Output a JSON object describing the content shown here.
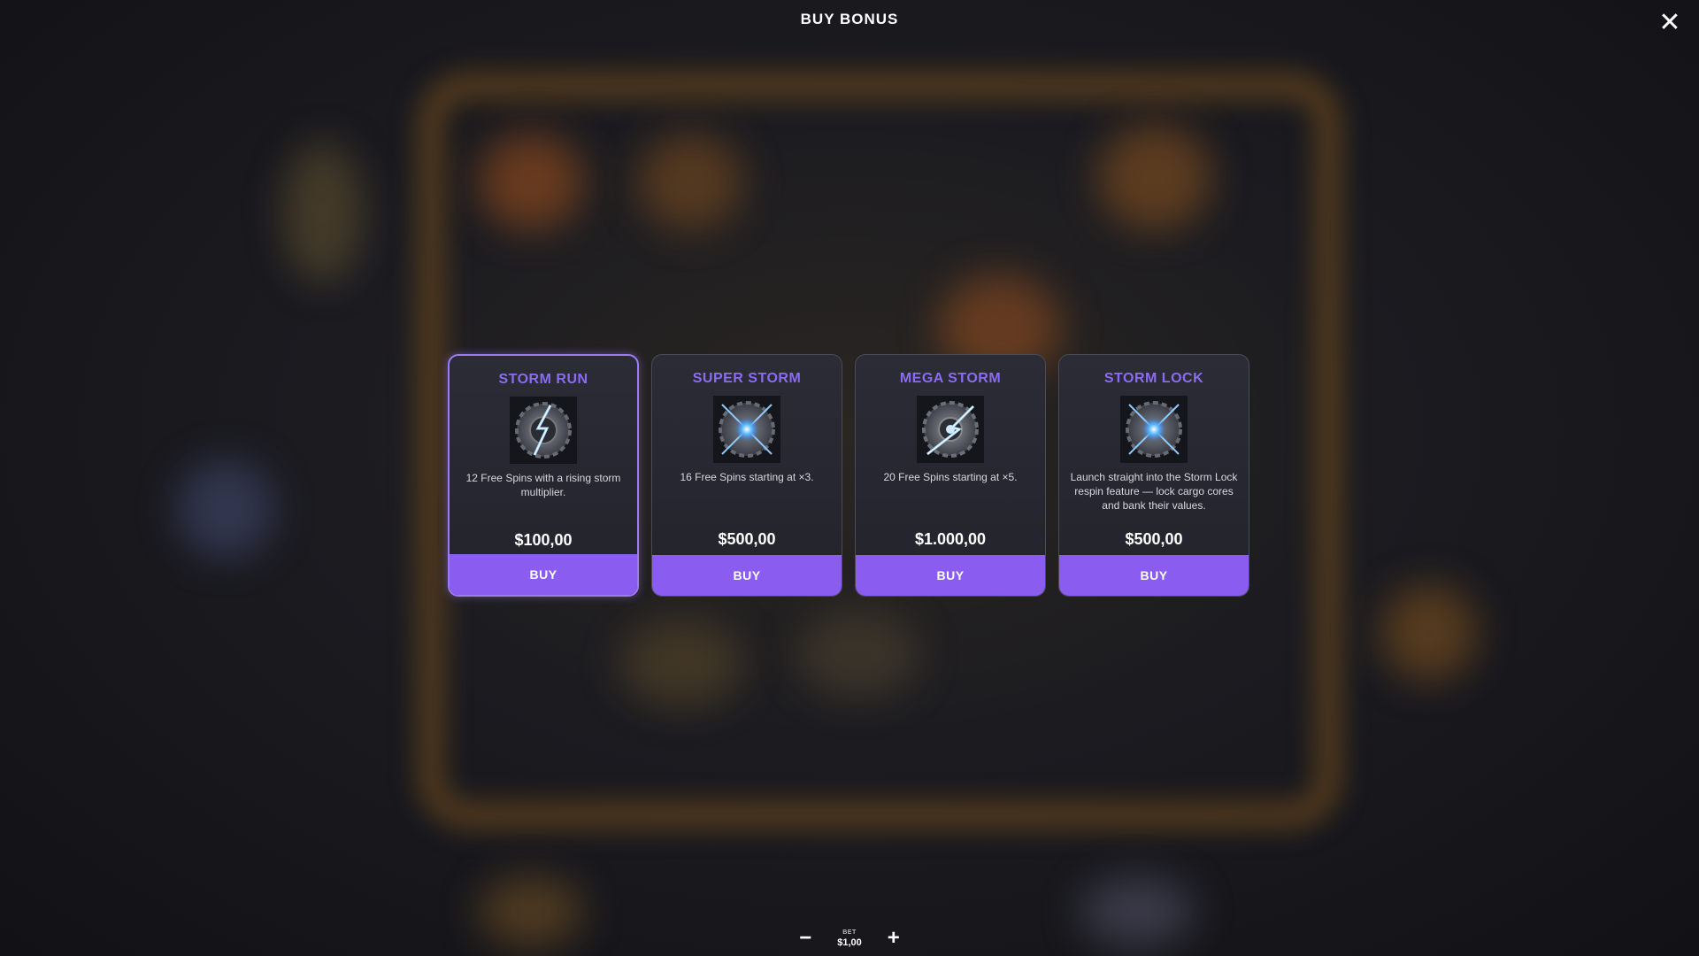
{
  "modal": {
    "title": "BUY BONUS",
    "close_icon": "close-icon"
  },
  "colors": {
    "accent": "#8b5cf0",
    "title_purple": "#8b6cf0",
    "card_bg": "#2b2c36",
    "selected_border": "#9b7cf4"
  },
  "bonuses": [
    {
      "name": "STORM RUN",
      "icon": "lightning-gear-icon",
      "description": "12 Free Spins with a rising storm multiplier.",
      "price": "$100,00",
      "buy_label": "BUY",
      "selected": true
    },
    {
      "name": "SUPER STORM",
      "icon": "storm-core-gear-icon",
      "description": "16 Free Spins starting at ×3.",
      "price": "$500,00",
      "buy_label": "BUY",
      "selected": false
    },
    {
      "name": "MEGA STORM",
      "icon": "lightning-gear-icon",
      "description": "20 Free Spins starting at ×5.",
      "price": "$1.000,00",
      "buy_label": "BUY",
      "selected": false
    },
    {
      "name": "STORM LOCK",
      "icon": "storm-core-gear-icon",
      "description": "Launch straight into the Storm Lock respin feature — lock cargo cores and bank their values.",
      "price": "$500,00",
      "buy_label": "BUY",
      "selected": false
    }
  ],
  "bet": {
    "label": "BET",
    "value": "$1,00",
    "decrease_symbol": "−",
    "increase_symbol": "+"
  }
}
